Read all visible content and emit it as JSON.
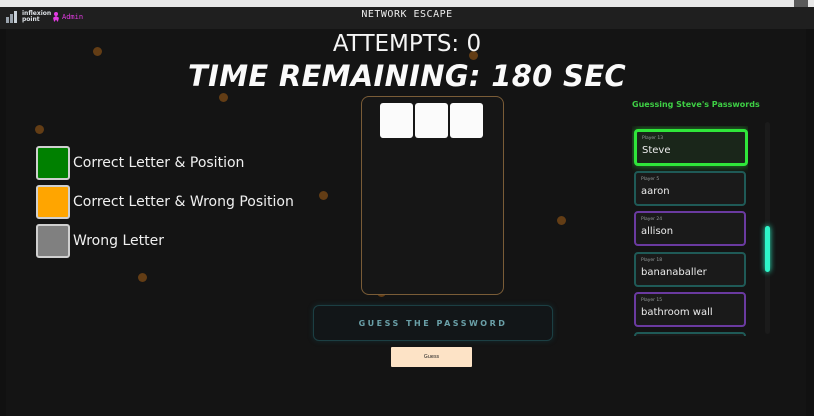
{
  "header": {
    "logo_text": "inflexion point",
    "admin_label": "Admin",
    "title": "NETWORK ESCAPE"
  },
  "status": {
    "attempts": "ATTEMPTS: 0",
    "timer": "TIME REMAINING: 180 SEC"
  },
  "legend": [
    {
      "label": "Correct Letter & Position",
      "color": "#008000"
    },
    {
      "label": "Correct Letter & Wrong Position",
      "color": "#ffa500"
    },
    {
      "label": "Wrong Letter",
      "color": "#808080"
    }
  ],
  "board": {
    "tile_count": 3,
    "tile_color": "#fbfbfb"
  },
  "guess": {
    "panel_text": "GUESS THE PASSWORD",
    "button_label": "Guess"
  },
  "sidebar": {
    "title": "Guessing Steve's Passwords",
    "players": [
      {
        "number": "Player 13",
        "name": "Steve",
        "state": "active"
      },
      {
        "number": "Player 5",
        "name": "aaron",
        "state": "teal"
      },
      {
        "number": "Player 24",
        "name": "allison",
        "state": "purple"
      },
      {
        "number": "Player 18",
        "name": "bananaballer",
        "state": "teal"
      },
      {
        "number": "Player 15",
        "name": "bathroom wall",
        "state": "purple"
      }
    ]
  },
  "colors": {
    "background": "#141414",
    "accent_green": "#3ecf45",
    "scrollbar": "#2ef5c9",
    "button": "#fde3c6"
  }
}
